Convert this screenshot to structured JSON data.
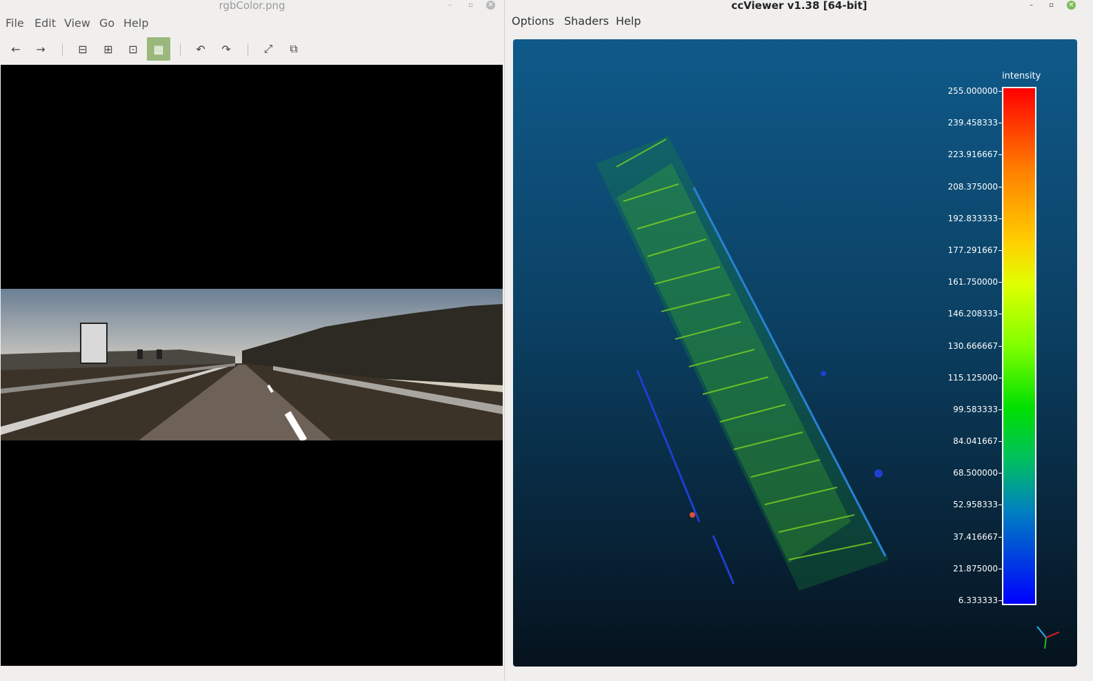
{
  "left_window": {
    "title": "rgbColor.png",
    "menu": [
      "File",
      "Edit",
      "View",
      "Go",
      "Help"
    ],
    "toolbar": [
      "arrow-left-icon",
      "arrow-right-icon",
      "zoom-out-icon",
      "zoom-in-icon",
      "zoom-normal-icon",
      "zoom-fit-icon",
      "rotate-left-icon",
      "rotate-right-icon",
      "fullscreen-icon",
      "slideshow-icon"
    ],
    "active_tool": "zoom-fit-icon"
  },
  "right_window": {
    "title": "ccViewer v1.38 [64-bit]",
    "menu": [
      "Options",
      "Shaders",
      "Help"
    ],
    "scalebar": {
      "title": "intensity",
      "labels": [
        "255.000000",
        "239.458333",
        "223.916667",
        "208.375000",
        "192.833333",
        "177.291667",
        "161.750000",
        "146.208333",
        "130.666667",
        "115.125000",
        "99.583333",
        "84.041667",
        "68.500000",
        "52.958333",
        "37.416667",
        "21.875000",
        "6.333333"
      ]
    }
  },
  "colors": {
    "active_tool": "#9ab87b",
    "close_button": "#7fba57",
    "canvas_top": "#0f5a8a",
    "canvas_bottom": "#06121d"
  }
}
